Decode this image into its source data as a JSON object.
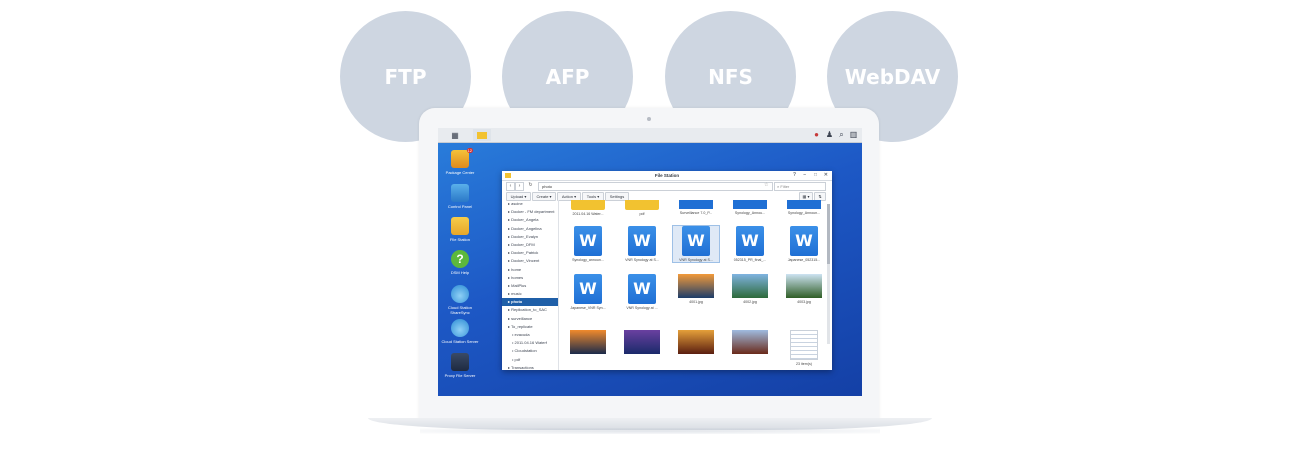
{
  "protocols": [
    "FTP",
    "AFP",
    "NFS",
    "WebDAV"
  ],
  "desktop_icons": [
    {
      "label": "Package Center",
      "badge": "12"
    },
    {
      "label": "Control Panel"
    },
    {
      "label": "File Station"
    },
    {
      "label": "DSM Help"
    },
    {
      "label": "Cloud Station ShareSync"
    },
    {
      "label": "Cloud Station Server"
    },
    {
      "label": "Proxy File Server"
    }
  ],
  "window": {
    "title": "File Station",
    "path": "photo",
    "filter_placeholder": "Filter",
    "toolbar": {
      "upload": "Upload ▾",
      "create": "Create ▾",
      "action": "Action ▾",
      "tools": "Tools ▾",
      "settings": "Settings"
    },
    "tree": [
      "ascine",
      "Docker - FM department",
      "Docker_Angela",
      "Docker_Angelina",
      "Docker_Evalyn",
      "Docker_DFM",
      "Docker_Patrick",
      "Docker_Vincent",
      "home",
      "homes",
      "MailPlus",
      "music",
      "photo",
      "Replication_to_SAC",
      "surveillance",
      "To_replicate",
      "• evacuda",
      "• 2011.04.16 Waterf",
      "• Cloudstation",
      "• pdf",
      "Transactions"
    ],
    "selected_tree_index": 12,
    "grid_items": [
      {
        "kind": "folder",
        "label": "2011.04.16 Water..."
      },
      {
        "kind": "folder",
        "label": "pdf"
      },
      {
        "kind": "bluebar",
        "label": "Surveillance 7.0_P..."
      },
      {
        "kind": "bluebar",
        "label": "Synology_Annou..."
      },
      {
        "kind": "bluebar",
        "label": "Synology_Announ..."
      },
      {
        "kind": "doc",
        "label": "Synology_announ..."
      },
      {
        "kind": "doc",
        "label": "VNR Synology at S..."
      },
      {
        "kind": "doc",
        "label": "VNR Synology at S..."
      },
      {
        "kind": "doc",
        "label": "052315_PR_final_..."
      },
      {
        "kind": "doc",
        "label": "Japanese_052315..."
      },
      {
        "kind": "doc",
        "label": "Japanese_VNR Syn..."
      },
      {
        "kind": "doc",
        "label": "VNR Synology at ..."
      },
      {
        "kind": "photo",
        "label": "4001.jpg",
        "c1": "#f29a3a",
        "c2": "#1d3d6a"
      },
      {
        "kind": "photo",
        "label": "4002.jpg",
        "c1": "#7fb3e0",
        "c2": "#2d6a3a"
      },
      {
        "kind": "photo",
        "label": "4003.jpg",
        "c1": "#cde3f2",
        "c2": "#2f5e26"
      },
      {
        "kind": "photo",
        "label": "",
        "c1": "#f08a2c",
        "c2": "#1b2a4a"
      },
      {
        "kind": "photo",
        "label": "",
        "c1": "#6a40a0",
        "c2": "#1a2a6a"
      },
      {
        "kind": "photo",
        "label": "",
        "c1": "#e5a03a",
        "c2": "#5a1e10"
      },
      {
        "kind": "photo",
        "label": "",
        "c1": "#9fbbe0",
        "c2": "#6a2a1a"
      },
      {
        "kind": "text",
        "label": "23 item(s)"
      }
    ]
  }
}
